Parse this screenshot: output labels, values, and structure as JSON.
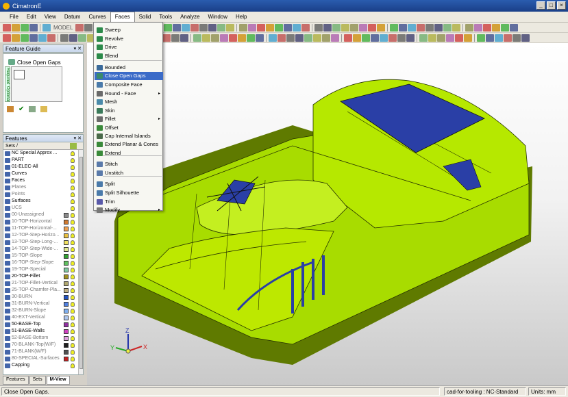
{
  "window": {
    "title": "CimatronE",
    "min": "_",
    "max": "□",
    "close": "×"
  },
  "menu": [
    "File",
    "Edit",
    "View",
    "Datum",
    "Curves",
    "Faces",
    "Solid",
    "Tools",
    "Analyze",
    "Window",
    "Help"
  ],
  "toolbar": {
    "model_label": "MODEL"
  },
  "faces_menu": {
    "items": [
      {
        "label": "Sweep",
        "icon": "sweep-icon"
      },
      {
        "label": "Revolve",
        "icon": "revolve-icon"
      },
      {
        "label": "Drive",
        "icon": "drive-icon"
      },
      {
        "label": "Blend",
        "icon": "blend-icon"
      },
      {
        "label": "Bounded",
        "icon": "bounded-icon"
      },
      {
        "label": "Close Open Gaps",
        "icon": "close-gaps-icon",
        "highlighted": true
      },
      {
        "label": "Composite Face",
        "icon": "composite-face-icon"
      },
      {
        "label": "Round - Face",
        "icon": "round-face-icon",
        "submenu": true
      },
      {
        "label": "Mesh",
        "icon": "mesh-icon"
      },
      {
        "label": "Skin",
        "icon": "skin-icon"
      },
      {
        "label": "Fillet",
        "icon": "fillet-icon",
        "submenu": true
      },
      {
        "label": "Offset",
        "icon": "offset-icon"
      },
      {
        "label": "Cap Internal Islands",
        "icon": "cap-islands-icon"
      },
      {
        "label": "Extend Planar & Cones",
        "icon": "extend-planar-icon"
      },
      {
        "label": "Extend",
        "icon": "extend-icon"
      },
      {
        "label": "Stitch",
        "icon": "stitch-icon"
      },
      {
        "label": "Unstitch",
        "icon": "unstitch-icon"
      },
      {
        "label": "Split",
        "icon": "split-icon"
      },
      {
        "label": "Split Silhouette",
        "icon": "split-silhouette-icon"
      },
      {
        "label": "Trim",
        "icon": "trim-icon"
      },
      {
        "label": "Modify",
        "icon": "modify-icon",
        "submenu": true
      }
    ],
    "highlight_color": "#3b6bc8",
    "submenu_arrow": "▸"
  },
  "feature_guide": {
    "title": "Feature Guide",
    "pins": "▾ ✕",
    "item": "Close Open Gaps",
    "tab_required": "Required",
    "tab_optional": "Optional",
    "ok_symbol": "✔"
  },
  "features_panel": {
    "title": "Features",
    "pins": "▾ ✕",
    "header": "Sets /",
    "rows": [
      {
        "name": "NC Special Approx ...",
        "style": "normal",
        "color": ""
      },
      {
        "name": "PART",
        "style": "normal",
        "color": ""
      },
      {
        "name": "01-ELEC-All",
        "style": "normal",
        "color": ""
      },
      {
        "name": "Curves",
        "style": "normal",
        "color": ""
      },
      {
        "name": "Faces",
        "style": "normal",
        "color": ""
      },
      {
        "name": "Planes",
        "style": "grey",
        "color": ""
      },
      {
        "name": "Points",
        "style": "grey",
        "color": ""
      },
      {
        "name": "Surfaces",
        "style": "normal",
        "color": ""
      },
      {
        "name": "UCS",
        "style": "grey",
        "color": ""
      },
      {
        "name": "00-Unassigned",
        "style": "grey",
        "color": "#8a8a8a"
      },
      {
        "name": "10-TOP-Horizontal",
        "style": "grey",
        "color": "#d07a30"
      },
      {
        "name": "11-TOP-Horizontal-...",
        "style": "grey",
        "color": "#f0a050"
      },
      {
        "name": "12-TOP-Step-Horizo...",
        "style": "grey",
        "color": "#e8c040"
      },
      {
        "name": "13-TOP-Step-Long-...",
        "style": "grey",
        "color": "#f0e060"
      },
      {
        "name": "14-TOP-Step-Wide-...",
        "style": "grey",
        "color": "#e0e890"
      },
      {
        "name": "15-TOP-Slope",
        "style": "grey",
        "color": "#30a030"
      },
      {
        "name": "16-TOP-Step-Slope",
        "style": "grey",
        "color": "#60c060"
      },
      {
        "name": "19-TOP-Special",
        "style": "grey",
        "color": "#80c8a0"
      },
      {
        "name": "20-TOP-Fillet",
        "style": "normal",
        "color": "#a09020"
      },
      {
        "name": "21-TOP-Fillet-Vertical",
        "style": "grey",
        "color": "#b0a870"
      },
      {
        "name": "25-TOP-Chamfer-Pla...",
        "style": "grey",
        "color": "#c0b080"
      },
      {
        "name": "30-BURN",
        "style": "grey",
        "color": "#2050c0"
      },
      {
        "name": "31-BURN-Vertical",
        "style": "grey",
        "color": "#5080e0"
      },
      {
        "name": "32-BURN-Slope",
        "style": "grey",
        "color": "#80b0f0"
      },
      {
        "name": "40-EXT-Vertical",
        "style": "grey",
        "color": "#b0c8f0"
      },
      {
        "name": "50-BASE-Top",
        "style": "normal",
        "color": "#9030a0"
      },
      {
        "name": "51-BASE-Walls",
        "style": "normal",
        "color": "#d040c0"
      },
      {
        "name": "52-BASE-Bottom",
        "style": "grey",
        "color": "#e0a0e0"
      },
      {
        "name": "70-BLANK-Top(W/F)",
        "style": "grey",
        "color": "#202020"
      },
      {
        "name": "71-BLANK(W/F)",
        "style": "grey",
        "color": "#505050"
      },
      {
        "name": "80-SPECIAL-Surfaces",
        "style": "grey",
        "color": "#c02020"
      },
      {
        "name": "Capping",
        "style": "normal",
        "color": ""
      }
    ]
  },
  "bottom_tabs": [
    "Features",
    "Sets",
    "M-View"
  ],
  "axes": {
    "x": "X",
    "y": "Y",
    "z": "Z"
  },
  "status": {
    "left": "Close Open Gaps.",
    "mode": "cad-for-tooling : NC-Standard",
    "units": "Units: mm"
  },
  "colors": {
    "model_green": "#b4e600",
    "model_blue": "#2a3fa6",
    "title_blue": "#1f4a9c"
  }
}
